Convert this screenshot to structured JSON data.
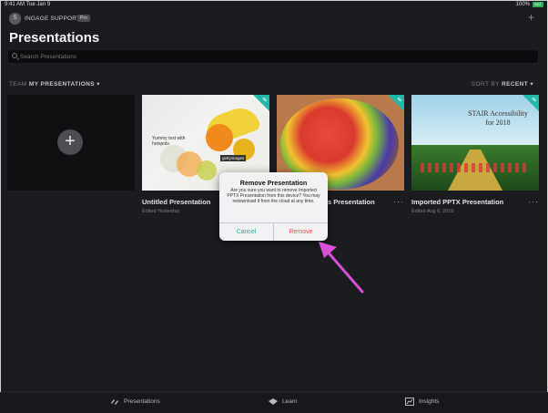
{
  "status": {
    "time": "9:41 AM",
    "date": "Tue Jan 9",
    "battery": "100%",
    "battery_badge": "BAT"
  },
  "account": {
    "initial": "S",
    "name": "INGAGE SUPPORT",
    "badge": "Pro"
  },
  "header": {
    "title": "Presentations",
    "add_symbol": "+"
  },
  "search": {
    "placeholder": "Search Presentations",
    "value": ""
  },
  "filters": {
    "team_prefix": "TEAM",
    "team_value": "MY PRESENTATIONS ▾",
    "sort_prefix": "SORT BY",
    "sort_value": "RECENT ▾"
  },
  "cards": [
    {
      "title": "",
      "subtitle": ""
    },
    {
      "title": "Untitled Presentation",
      "subtitle": "Edited Yesterday",
      "thumb_text": "Yummy text with hotspots",
      "thumb_badge": "gettyimages"
    },
    {
      "title": "s Presentation",
      "subtitle": ""
    },
    {
      "title": "Imported PPTX Presentation",
      "subtitle": "Edited Aug 6, 2019",
      "thumb_text": "STAIR Accessibility for 2018"
    }
  ],
  "dialog": {
    "title": "Remove Presentation",
    "message": "Are you sure you want to remove Imported PPTX Presentation from this device? You may redownload it from the cloud at any time.",
    "cancel_label": "Cancel",
    "remove_label": "Remove"
  },
  "tabs": [
    {
      "label": "Presentations",
      "icon": "presentations-icon"
    },
    {
      "label": "Learn",
      "icon": "learn-icon"
    },
    {
      "label": "Insights",
      "icon": "insights-icon"
    }
  ],
  "colors": {
    "accent": "#22b8a7",
    "destructive": "#e0504a",
    "annotation_arrow": "#d84fd8"
  }
}
